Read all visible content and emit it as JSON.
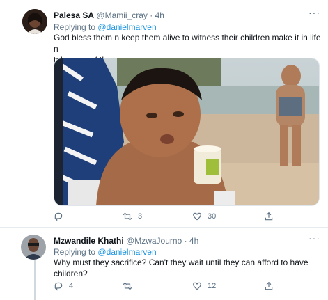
{
  "tweet1": {
    "name": "Palesa SA",
    "handle": "@Mamii_cray",
    "dot": "·",
    "time": "4h",
    "replying_prefix": "Replying to",
    "replying_to": "@danielmarven",
    "text_line1": "God bless them n keep them alive to witness their children make it in life n",
    "text_line2": "take care of them",
    "retweets": "3",
    "likes": "30",
    "more": "···"
  },
  "tweet2": {
    "name": "Mzwandile Khathi",
    "handle": "@MzwaJourno",
    "dot": "·",
    "time": "4h",
    "replying_prefix": "Replying to",
    "replying_to": "@danielmarven",
    "text_line1": "Why must they sacrifice? Can't they wait until they can afford to have",
    "text_line2": "children?",
    "replies": "4",
    "likes": "12",
    "more": "···"
  },
  "colors": {
    "link": "#1b95e0",
    "muted": "#5b7083",
    "border": "#e6ecf0"
  },
  "icons": [
    "reply-icon",
    "retweet-icon",
    "like-icon",
    "share-icon",
    "more-icon"
  ]
}
